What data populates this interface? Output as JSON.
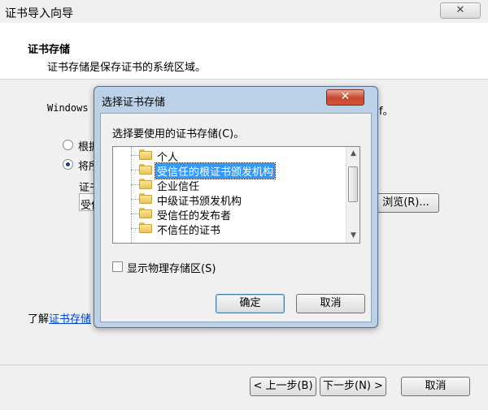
{
  "wizard": {
    "title": "证书导入向导",
    "close_label": "✕",
    "header_title": "证书存储",
    "header_subtitle": "证书存储是保存证书的系统区域。",
    "description_start": "Windows",
    "description_end": "f。",
    "radio_auto_label": "根据",
    "radio_manual_label": "将所",
    "store_label": "证书",
    "store_value": "受信",
    "browse_label": "浏览(R)...",
    "learn_more_prefix": "了解",
    "learn_more_link": "证书存储",
    "back_label": "< 上一步(B)",
    "next_label": "下一步(N) >",
    "cancel_label": "取消"
  },
  "dialog": {
    "title": "选择证书存储",
    "close_label": "✕",
    "prompt": "选择要使用的证书存储(C)。",
    "stores": [
      {
        "label": "个人",
        "selected": false
      },
      {
        "label": "受信任的根证书颁发机构",
        "selected": true
      },
      {
        "label": "企业信任",
        "selected": false
      },
      {
        "label": "中级证书颁发机构",
        "selected": false
      },
      {
        "label": "受信任的发布者",
        "selected": false
      },
      {
        "label": "不信任的证书",
        "selected": false
      }
    ],
    "show_physical_label": "显示物理存储区(S)",
    "show_physical_checked": false,
    "ok_label": "确定",
    "cancel_label": "取消"
  }
}
